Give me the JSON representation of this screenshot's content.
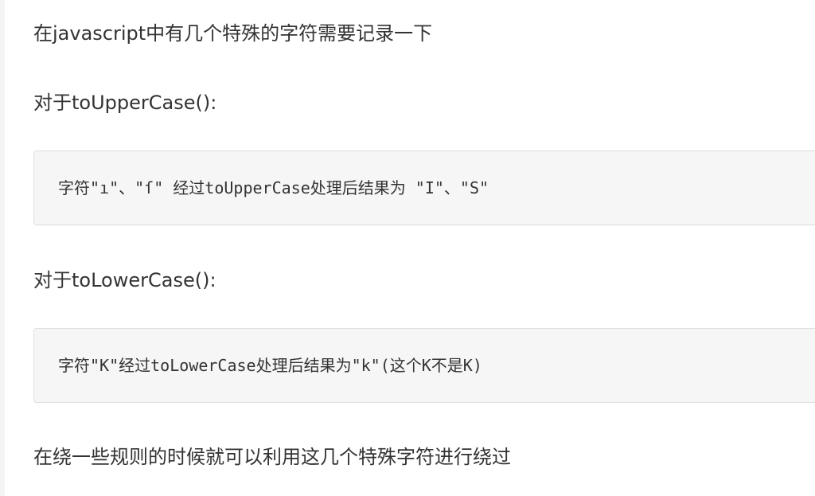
{
  "article": {
    "intro": "在javascript中有几个特殊的字符需要记录一下",
    "upper_heading": "对于toUpperCase():",
    "upper_code": "字符\"ı\"、\"ſ\" 经过toUpperCase处理后结果为 \"I\"、\"S\"",
    "lower_heading": "对于toLowerCase():",
    "lower_code": "字符\"K\"经过toLowerCase处理后结果为\"k\"(这个K不是K)",
    "conclusion": "在绕一些规则的时候就可以利用这几个特殊字符进行绕过"
  }
}
